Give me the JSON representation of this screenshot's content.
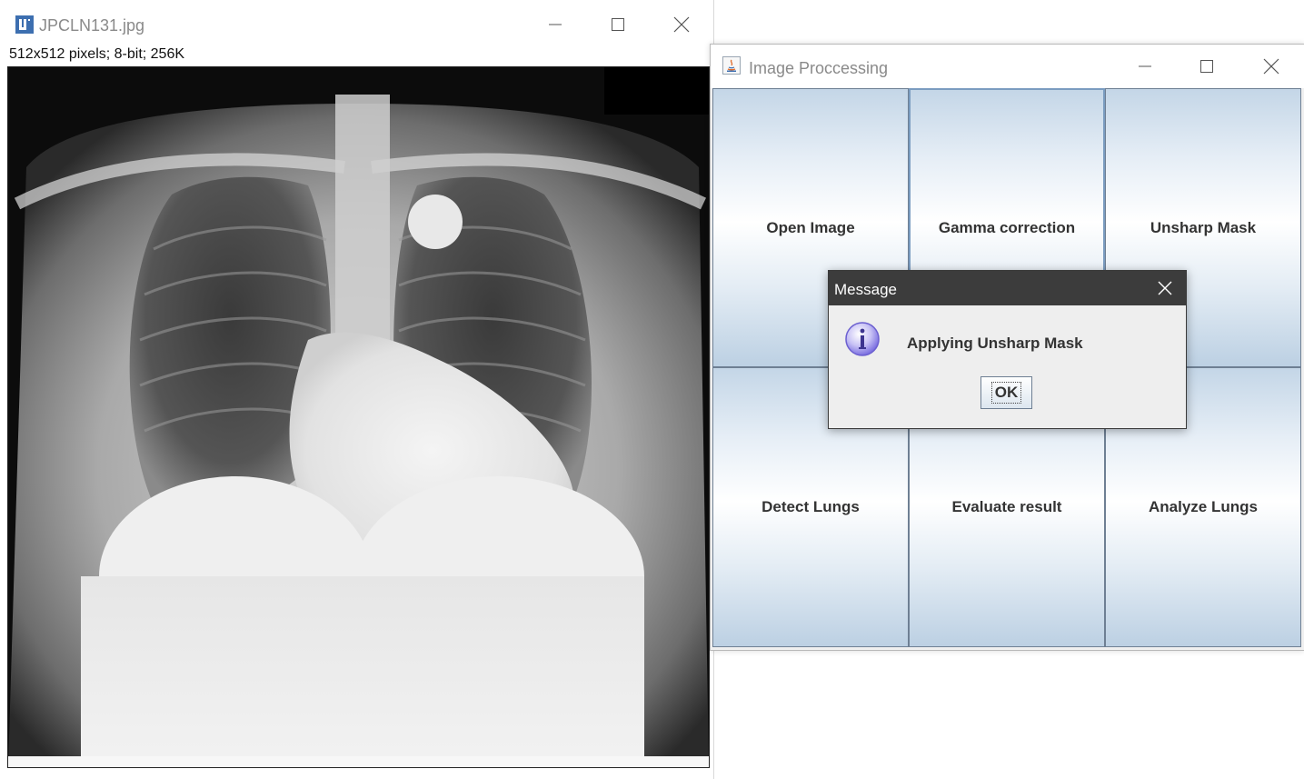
{
  "image_window": {
    "title": "JPCLN131.jpg",
    "info": "512x512 pixels; 8-bit; 256K",
    "icons": {
      "app": "imagej-icon",
      "minimize": "minimize-icon",
      "maximize": "maximize-icon",
      "close": "close-icon"
    }
  },
  "app_window": {
    "title": "Image Proccessing",
    "buttons": [
      {
        "label": "Open Image"
      },
      {
        "label": "Gamma correction"
      },
      {
        "label": "Unsharp Mask"
      },
      {
        "label": "Detect Lungs"
      },
      {
        "label": "Evaluate result"
      },
      {
        "label": "Analyze Lungs"
      }
    ],
    "icons": {
      "app": "java-icon",
      "minimize": "minimize-icon",
      "maximize": "maximize-icon",
      "close": "close-icon"
    }
  },
  "dialog": {
    "title": "Message",
    "message": "Applying Unsharp Mask",
    "ok_label": "OK",
    "icons": {
      "info": "info-icon",
      "close": "close-icon"
    }
  },
  "colors": {
    "button_gradient_edge": "#c4d6e7",
    "button_border": "#6e7f93",
    "dialog_title_bg": "#3c3c3c",
    "info_icon": "#7b6fe0"
  }
}
